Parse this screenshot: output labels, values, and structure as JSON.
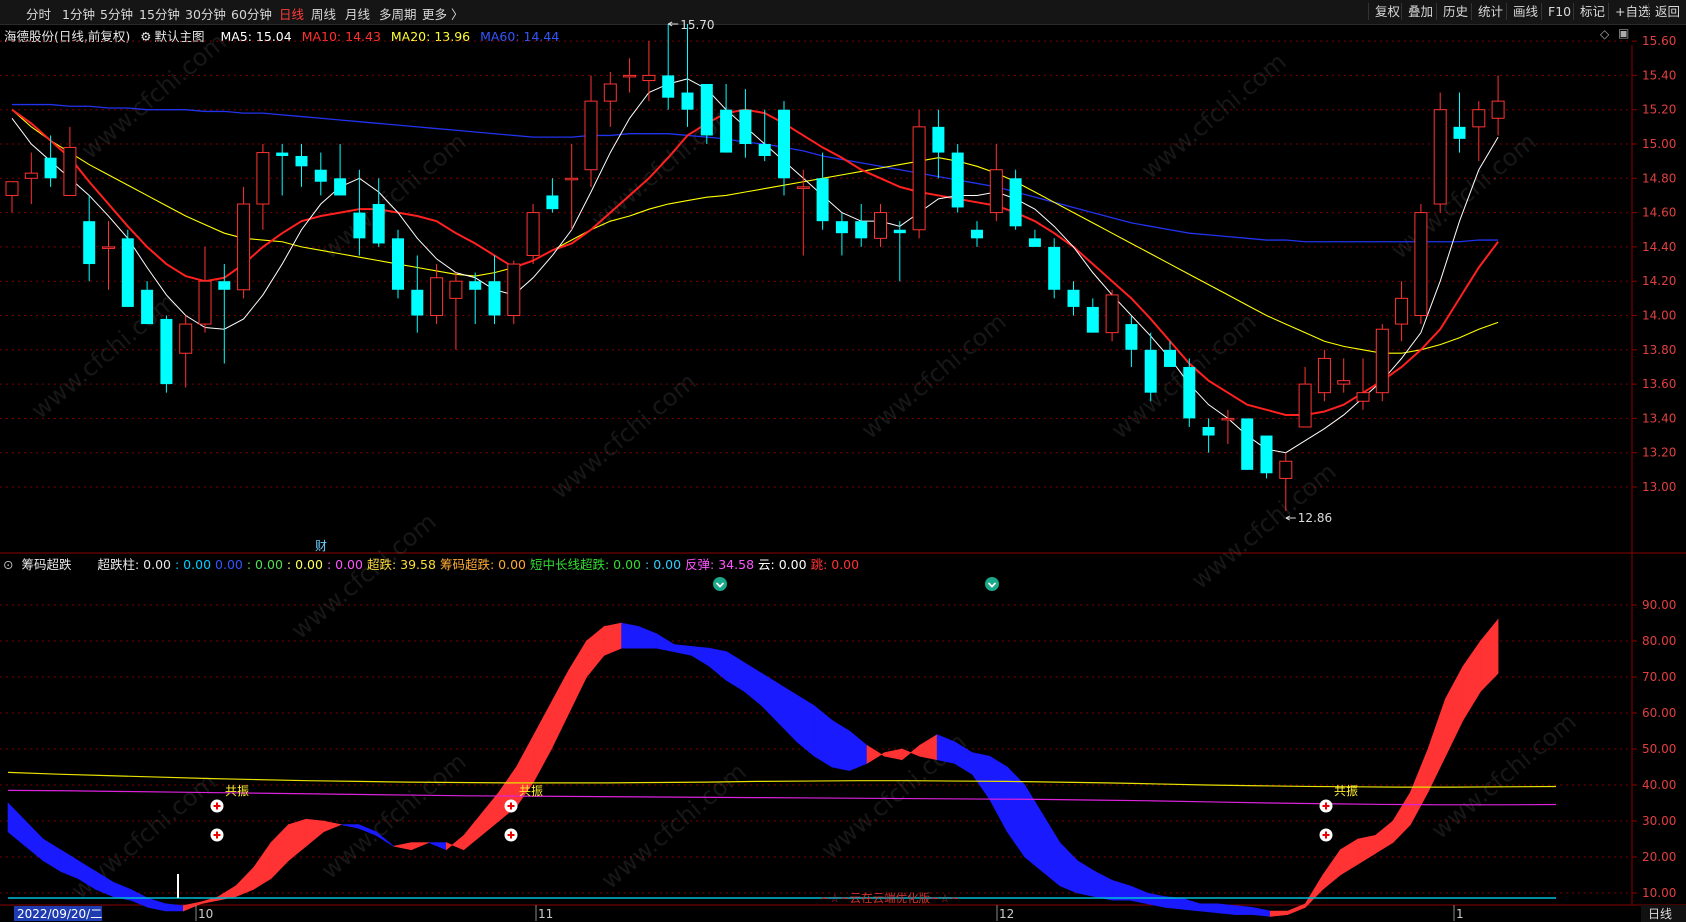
{
  "toolbar": {
    "periods": [
      "分时",
      "1分钟",
      "5分钟",
      "15分钟",
      "30分钟",
      "60分钟",
      "日线",
      "周线",
      "月线",
      "多周期",
      "更多 〉"
    ],
    "active_period": "日线",
    "right_buttons": [
      "复权",
      "叠加",
      "历史",
      "统计",
      "画线",
      "F10",
      "标记",
      "+自选",
      "返回"
    ]
  },
  "price_panel": {
    "stock": "海德股份(日线,前复权)",
    "main_label": "默认主图",
    "ma5": "MA5: 15.04",
    "ma10": "MA10: 14.43",
    "ma20": "MA20: 13.96",
    "ma60": "MA60: 14.44",
    "high_label": "15.70",
    "low_label": "12.86",
    "cai_marker": "财",
    "y_ticks": [
      "15.60",
      "15.40",
      "15.20",
      "15.00",
      "14.80",
      "14.60",
      "14.40",
      "14.20",
      "14.00",
      "13.80",
      "13.60",
      "13.40",
      "13.20",
      "13.00"
    ]
  },
  "indicator_panel": {
    "name": "筹码超跌",
    "labels": [
      {
        "text": "超跌柱: 0.00",
        "color": "#e8e8e8"
      },
      {
        "text": ": 0.00",
        "color": "#00ccff"
      },
      {
        "text": "0.00",
        "color": "#3355ff"
      },
      {
        "text": ": 0.00",
        "color": "#55dd55"
      },
      {
        "text": ": 0.00",
        "color": "#ffff66"
      },
      {
        "text": ": 0.00",
        "color": "#ff55ff"
      },
      {
        "text": "超跌: 39.58",
        "color": "#ffdd33"
      },
      {
        "text": "筹码超跌: 0.00",
        "color": "#ffaa33"
      },
      {
        "text": "短中长线超跌: 0.00",
        "color": "#33dd33"
      },
      {
        "text": ": 0.00",
        "color": "#33ccff"
      },
      {
        "text": "反弹: 34.58",
        "color": "#ff55ff"
      },
      {
        "text": "云: 0.00",
        "color": "#ffffff"
      },
      {
        "text": "跳: 0.00",
        "color": "#ff3333"
      }
    ],
    "y_ticks": [
      "90.00",
      "80.00",
      "70.00",
      "60.00",
      "50.00",
      "40.00",
      "30.00",
      "20.00",
      "10.00"
    ],
    "gongzhen": "共振",
    "footer_text": "~☆~云在云端优化版~☆~"
  },
  "x_axis": {
    "start_date": "2022/09/20/二",
    "months": [
      "10",
      "11",
      "12",
      "1"
    ],
    "period_label": "日线"
  },
  "watermark": "www.cfchi.com",
  "colors": {
    "up": "#ff3333",
    "down": "#00ffff",
    "ma5": "#ffffff",
    "ma10": "#ff2020",
    "ma20": "#ffff00",
    "ma60": "#2233ee",
    "band_up": "#ff3333",
    "band_down": "#1a1aff"
  },
  "chart_data": {
    "type": "candlestick",
    "candles_ohlc": [
      [
        14.7,
        14.78,
        14.6,
        14.78
      ],
      [
        14.8,
        14.95,
        14.65,
        14.83
      ],
      [
        14.92,
        15.05,
        14.75,
        14.8
      ],
      [
        14.7,
        15.1,
        14.7,
        14.98
      ],
      [
        14.55,
        14.7,
        14.2,
        14.3
      ],
      [
        14.4,
        14.55,
        14.15,
        14.4
      ],
      [
        14.45,
        14.5,
        14.05,
        14.05
      ],
      [
        14.15,
        14.2,
        13.95,
        13.95
      ],
      [
        13.98,
        14.0,
        13.55,
        13.6
      ],
      [
        13.78,
        14.0,
        13.58,
        13.95
      ],
      [
        13.95,
        14.4,
        13.9,
        14.2
      ],
      [
        14.2,
        14.3,
        13.72,
        14.15
      ],
      [
        14.15,
        14.75,
        14.1,
        14.65
      ],
      [
        14.65,
        15.0,
        14.5,
        14.95
      ],
      [
        14.95,
        15.0,
        14.7,
        14.93
      ],
      [
        14.93,
        15.0,
        14.75,
        14.87
      ],
      [
        14.85,
        14.95,
        14.7,
        14.78
      ],
      [
        14.8,
        15.0,
        14.7,
        14.7
      ],
      [
        14.6,
        14.85,
        14.35,
        14.45
      ],
      [
        14.65,
        14.8,
        14.4,
        14.42
      ],
      [
        14.45,
        14.5,
        14.1,
        14.15
      ],
      [
        14.15,
        14.35,
        13.9,
        14.0
      ],
      [
        14.0,
        14.3,
        13.95,
        14.22
      ],
      [
        14.1,
        14.25,
        13.8,
        14.2
      ],
      [
        14.2,
        14.25,
        13.95,
        14.15
      ],
      [
        14.2,
        14.35,
        13.95,
        14.0
      ],
      [
        14.0,
        14.32,
        13.95,
        14.3
      ],
      [
        14.35,
        14.65,
        14.3,
        14.6
      ],
      [
        14.7,
        14.8,
        14.6,
        14.62
      ],
      [
        14.8,
        15.0,
        14.5,
        14.8
      ],
      [
        14.85,
        15.4,
        14.75,
        15.25
      ],
      [
        15.25,
        15.42,
        15.1,
        15.35
      ],
      [
        15.4,
        15.5,
        15.3,
        15.4
      ],
      [
        15.37,
        15.6,
        15.25,
        15.4
      ],
      [
        15.4,
        15.7,
        15.2,
        15.27
      ],
      [
        15.3,
        15.7,
        15.1,
        15.2
      ],
      [
        15.35,
        15.35,
        15.0,
        15.05
      ],
      [
        15.2,
        15.35,
        14.95,
        14.95
      ],
      [
        15.2,
        15.32,
        14.92,
        15.0
      ],
      [
        15.0,
        15.2,
        14.9,
        14.93
      ],
      [
        15.2,
        15.25,
        14.7,
        14.8
      ],
      [
        14.75,
        14.85,
        14.35,
        14.75
      ],
      [
        14.8,
        14.95,
        14.5,
        14.55
      ],
      [
        14.55,
        14.6,
        14.35,
        14.48
      ],
      [
        14.55,
        14.65,
        14.4,
        14.45
      ],
      [
        14.45,
        14.65,
        14.4,
        14.6
      ],
      [
        14.5,
        14.55,
        14.2,
        14.48
      ],
      [
        14.5,
        15.2,
        14.45,
        15.1
      ],
      [
        15.1,
        15.2,
        14.8,
        14.95
      ],
      [
        14.95,
        15.0,
        14.6,
        14.63
      ],
      [
        14.5,
        14.55,
        14.4,
        14.45
      ],
      [
        14.6,
        15.0,
        14.55,
        14.85
      ],
      [
        14.8,
        14.85,
        14.5,
        14.52
      ],
      [
        14.45,
        14.5,
        14.4,
        14.4
      ],
      [
        14.4,
        14.45,
        14.1,
        14.15
      ],
      [
        14.15,
        14.2,
        14.0,
        14.05
      ],
      [
        14.05,
        14.1,
        13.9,
        13.9
      ],
      [
        13.9,
        14.15,
        13.85,
        14.12
      ],
      [
        13.95,
        14.0,
        13.7,
        13.8
      ],
      [
        13.8,
        13.9,
        13.5,
        13.55
      ],
      [
        13.8,
        13.85,
        13.7,
        13.7
      ],
      [
        13.7,
        13.75,
        13.35,
        13.4
      ],
      [
        13.35,
        13.4,
        13.2,
        13.3
      ],
      [
        13.4,
        13.45,
        13.25,
        13.4
      ],
      [
        13.4,
        13.4,
        13.1,
        13.1
      ],
      [
        13.3,
        13.3,
        13.05,
        13.08
      ],
      [
        13.05,
        13.2,
        12.86,
        13.15
      ],
      [
        13.35,
        13.7,
        13.35,
        13.6
      ],
      [
        13.55,
        13.8,
        13.5,
        13.75
      ],
      [
        13.6,
        13.75,
        13.55,
        13.62
      ],
      [
        13.5,
        13.75,
        13.45,
        13.55
      ],
      [
        13.55,
        13.95,
        13.5,
        13.92
      ],
      [
        13.95,
        14.2,
        13.85,
        14.1
      ],
      [
        14.0,
        14.65,
        13.95,
        14.6
      ],
      [
        14.65,
        15.3,
        14.6,
        15.2
      ],
      [
        15.1,
        15.3,
        14.95,
        15.03
      ],
      [
        15.1,
        15.25,
        14.9,
        15.2
      ],
      [
        15.15,
        15.4,
        15.05,
        15.25
      ]
    ],
    "ma5": [
      15.15,
      15.0,
      14.9,
      14.8,
      14.7,
      14.58,
      14.45,
      14.28,
      14.12,
      14.0,
      13.93,
      13.92,
      13.98,
      14.12,
      14.3,
      14.5,
      14.65,
      14.75,
      14.8,
      14.72,
      14.6,
      14.45,
      14.33,
      14.25,
      14.22,
      14.15,
      14.12,
      14.22,
      14.35,
      14.5,
      14.72,
      14.95,
      15.15,
      15.3,
      15.35,
      15.38,
      15.32,
      15.2,
      15.1,
      15.0,
      14.9,
      14.8,
      14.7,
      14.6,
      14.55,
      14.55,
      14.52,
      14.6,
      14.68,
      14.7,
      14.7,
      14.72,
      14.68,
      14.62,
      14.52,
      14.4,
      14.25,
      14.12,
      14.0,
      13.88,
      13.75,
      13.6,
      13.48,
      13.4,
      13.3,
      13.22,
      13.2,
      13.27,
      13.34,
      13.42,
      13.52,
      13.62,
      13.75,
      13.9,
      14.2,
      14.55,
      14.85,
      15.04
    ],
    "ma10": [
      15.2,
      15.12,
      15.02,
      14.92,
      14.78,
      14.65,
      14.52,
      14.4,
      14.3,
      14.23,
      14.2,
      14.22,
      14.3,
      14.4,
      14.48,
      14.55,
      14.58,
      14.6,
      14.62,
      14.62,
      14.6,
      14.58,
      14.55,
      14.48,
      14.42,
      14.35,
      14.28,
      14.32,
      14.38,
      14.42,
      14.5,
      14.6,
      14.7,
      14.8,
      14.92,
      15.05,
      15.12,
      15.18,
      15.2,
      15.18,
      15.12,
      15.05,
      14.98,
      14.92,
      14.85,
      14.8,
      14.75,
      14.72,
      14.7,
      14.68,
      14.66,
      14.64,
      14.6,
      14.55,
      14.48,
      14.4,
      14.3,
      14.2,
      14.1,
      13.98,
      13.85,
      13.72,
      13.62,
      13.55,
      13.48,
      13.45,
      13.42,
      13.42,
      13.44,
      13.48,
      13.55,
      13.62,
      13.7,
      13.8,
      13.92,
      14.1,
      14.28,
      14.43
    ],
    "ma20": [
      15.2,
      15.1,
      15.02,
      14.95,
      14.88,
      14.82,
      14.76,
      14.7,
      14.64,
      14.58,
      14.53,
      14.48,
      14.45,
      14.44,
      14.43,
      14.4,
      14.38,
      14.36,
      14.34,
      14.32,
      14.3,
      14.28,
      14.26,
      14.24,
      14.23,
      14.25,
      14.28,
      14.32,
      14.38,
      14.44,
      14.5,
      14.55,
      14.58,
      14.62,
      14.65,
      14.67,
      14.69,
      14.7,
      14.72,
      14.74,
      14.76,
      14.78,
      14.8,
      14.82,
      14.84,
      14.86,
      14.88,
      14.9,
      14.92,
      14.9,
      14.87,
      14.83,
      14.78,
      14.72,
      14.66,
      14.6,
      14.54,
      14.48,
      14.42,
      14.36,
      14.3,
      14.24,
      14.18,
      14.12,
      14.06,
      14.0,
      13.95,
      13.9,
      13.85,
      13.82,
      13.8,
      13.78,
      13.78,
      13.8,
      13.83,
      13.87,
      13.92,
      13.96
    ],
    "ma60": [
      15.23,
      15.23,
      15.23,
      15.22,
      15.22,
      15.21,
      15.21,
      15.2,
      15.2,
      15.2,
      15.19,
      15.19,
      15.18,
      15.18,
      15.17,
      15.16,
      15.15,
      15.14,
      15.13,
      15.12,
      15.11,
      15.1,
      15.09,
      15.08,
      15.07,
      15.06,
      15.05,
      15.04,
      15.04,
      15.04,
      15.05,
      15.05,
      15.06,
      15.06,
      15.06,
      15.05,
      15.04,
      15.03,
      15.01,
      15.0,
      14.98,
      14.96,
      14.93,
      14.91,
      14.89,
      14.87,
      14.85,
      14.83,
      14.81,
      14.79,
      14.77,
      14.75,
      14.72,
      14.69,
      14.66,
      14.63,
      14.6,
      14.57,
      14.54,
      14.52,
      14.5,
      14.48,
      14.47,
      14.46,
      14.45,
      14.44,
      14.44,
      14.43,
      14.43,
      14.43,
      14.43,
      14.43,
      14.43,
      14.43,
      14.43,
      14.43,
      14.44,
      14.44
    ],
    "band_a": [
      35,
      30,
      25,
      22,
      19,
      16,
      13,
      11,
      8.5,
      7,
      6.5,
      7.5,
      9,
      12,
      17,
      24,
      29,
      30.5,
      30,
      29,
      28,
      26,
      23,
      24,
      24,
      22,
      26,
      32,
      38,
      45,
      54,
      63,
      72,
      80,
      84,
      85,
      84,
      82,
      79,
      78.5,
      78,
      77,
      74,
      71,
      68,
      65,
      62,
      58,
      55,
      51,
      48,
      47,
      51,
      54,
      52,
      49,
      48,
      45,
      40,
      32,
      24,
      19,
      16,
      13.5,
      12,
      10,
      9,
      8.5,
      7,
      7,
      6.5,
      6,
      5,
      5,
      7,
      15,
      22,
      25,
      26,
      30,
      38,
      50,
      64,
      73,
      80,
      86
    ],
    "band_b": [
      27,
      23,
      19,
      16,
      14,
      11,
      9,
      8,
      6,
      5,
      5,
      7,
      8,
      9,
      11,
      14,
      19,
      23,
      27,
      29,
      29,
      27,
      23,
      22,
      24,
      24,
      22,
      26,
      30,
      34,
      41,
      50,
      60,
      70,
      76,
      78,
      78,
      78,
      77,
      76,
      73,
      69,
      66,
      62,
      57,
      52,
      48,
      45,
      44,
      46,
      49,
      50,
      48,
      47,
      46,
      43,
      36,
      27,
      20,
      16,
      12,
      10,
      9,
      8,
      8,
      7,
      6,
      5.5,
      5,
      4.5,
      4,
      4,
      3.5,
      4,
      6,
      11,
      15,
      18,
      21,
      24,
      29,
      38,
      48,
      58,
      66,
      71
    ],
    "yellow_line": [
      43.5,
      43.0,
      42.6,
      42.2,
      41.8,
      41.5,
      41.2,
      41.0,
      40.8,
      40.7,
      40.6,
      40.6,
      40.6,
      40.7,
      40.8,
      41.0,
      41.1,
      41.2,
      41.2,
      41.1,
      41.0,
      40.8,
      40.6,
      40.3,
      40.0,
      39.8,
      39.6,
      39.5,
      39.4,
      39.4,
      39.5,
      39.58
    ],
    "magenta_line": [
      38.5,
      38.4,
      38.2,
      38.0,
      37.8,
      37.6,
      37.4,
      37.2,
      37.0,
      36.9,
      36.8,
      36.7,
      36.6,
      36.5,
      36.4,
      36.3,
      36.2,
      36.1,
      36.0,
      35.8,
      35.6,
      35.3,
      35.0,
      34.8,
      34.6,
      34.5,
      34.5,
      34.58
    ]
  }
}
